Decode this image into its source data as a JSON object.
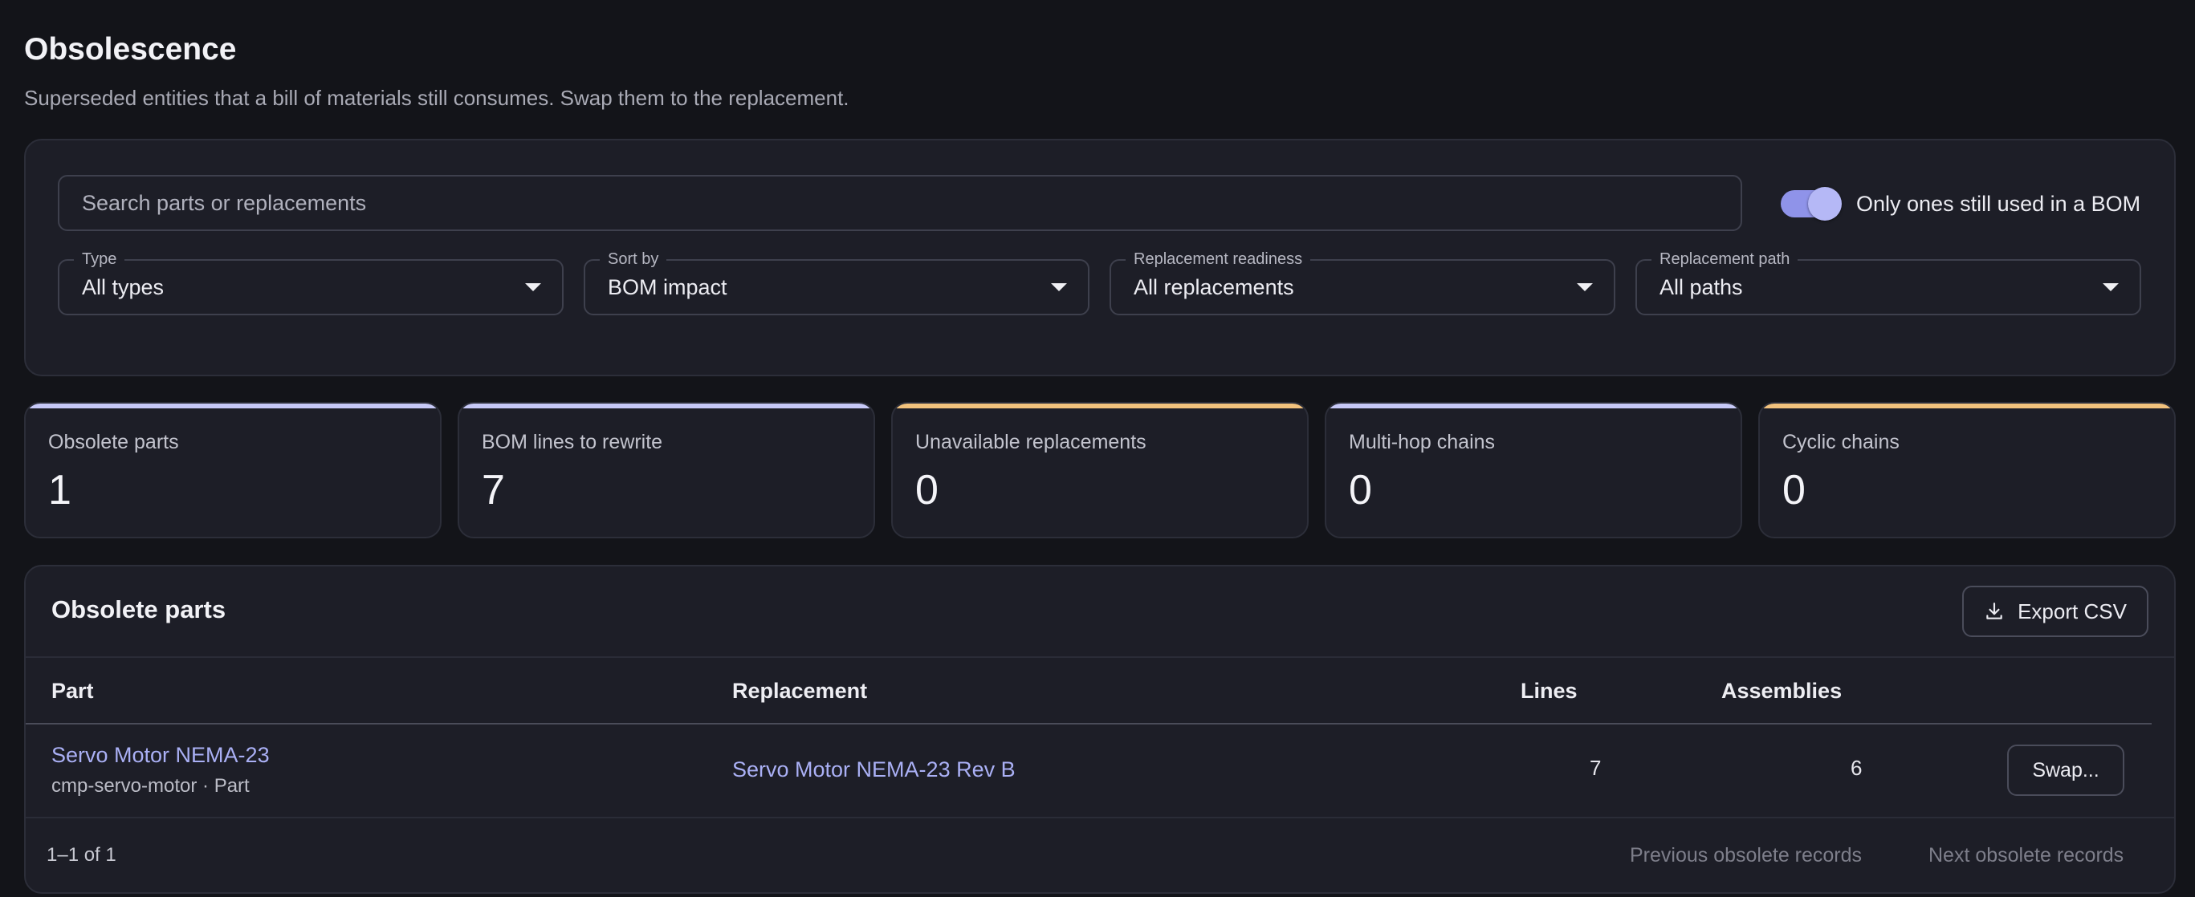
{
  "header": {
    "title": "Obsolescence",
    "subtitle": "Superseded entities that a bill of materials still consumes. Swap them to the replacement."
  },
  "filters": {
    "search_placeholder": "Search parts or replacements",
    "toggle_label": "Only ones still used in a BOM",
    "toggle_on": true,
    "selects": [
      {
        "label": "Type",
        "value": "All types"
      },
      {
        "label": "Sort by",
        "value": "BOM impact"
      },
      {
        "label": "Replacement readiness",
        "value": "All replacements"
      },
      {
        "label": "Replacement path",
        "value": "All paths"
      }
    ]
  },
  "kpis": [
    {
      "label": "Obsolete parts",
      "value": "1",
      "accent": "#c7c9f7"
    },
    {
      "label": "BOM lines to rewrite",
      "value": "7",
      "accent": "#c7c9f7"
    },
    {
      "label": "Unavailable replacements",
      "value": "0",
      "accent": "#f2c27d"
    },
    {
      "label": "Multi-hop chains",
      "value": "0",
      "accent": "#c7c9f7"
    },
    {
      "label": "Cyclic chains",
      "value": "0",
      "accent": "#f2c27d"
    }
  ],
  "table": {
    "title": "Obsolete parts",
    "export_label": "Export CSV",
    "columns": {
      "part": "Part",
      "replacement": "Replacement",
      "lines": "Lines",
      "assemblies": "Assemblies"
    },
    "rows": [
      {
        "part": "Servo Motor NEMA-23",
        "part_meta": "cmp-servo-motor · Part",
        "replacement": "Servo Motor NEMA-23 Rev B",
        "lines": "7",
        "assemblies": "6",
        "action": "Swap..."
      }
    ],
    "pager": {
      "count": "1–1 of 1",
      "prev": "Previous obsolete records",
      "next": "Next obsolete records"
    }
  },
  "colors": {
    "background": "#131419",
    "card": "#1d1e27",
    "link": "#aab0f5",
    "toggle": "#8f93e9"
  }
}
